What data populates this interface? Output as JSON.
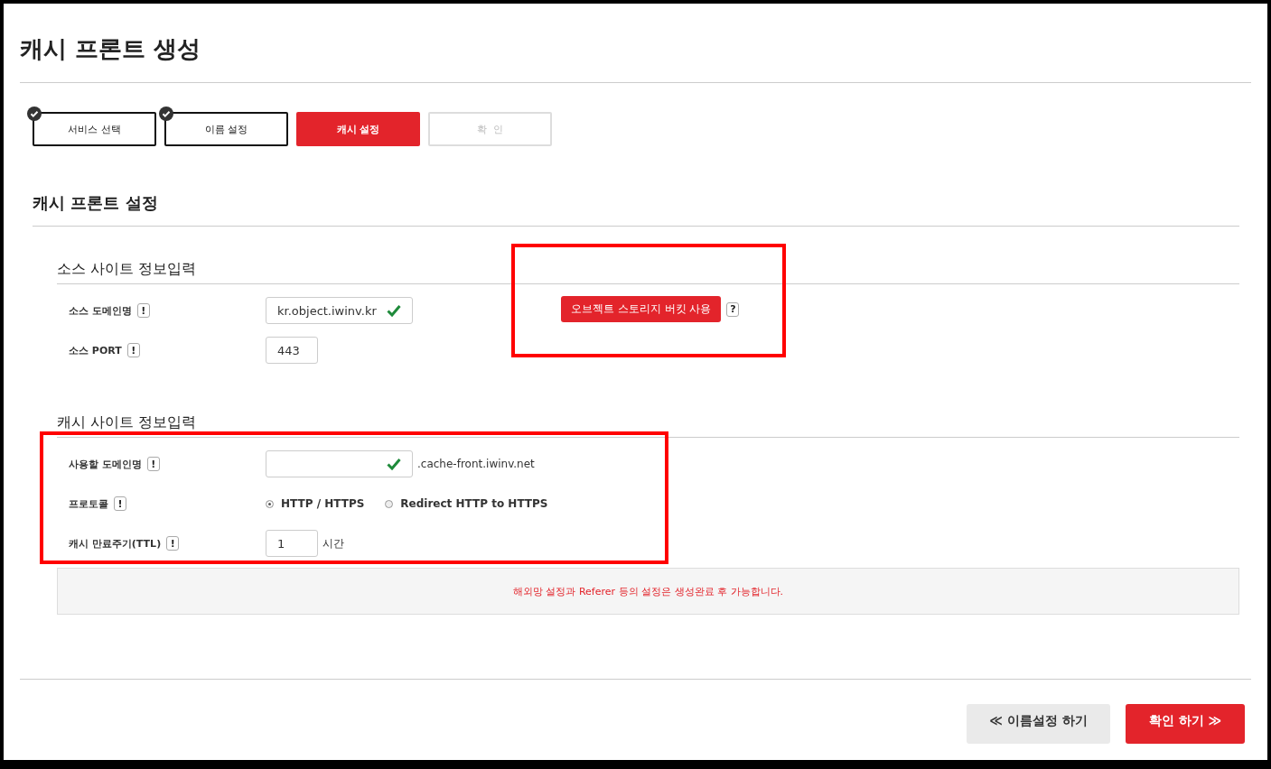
{
  "page_title": "캐시 프론트 생성",
  "steps": [
    {
      "label": "서비스 선택",
      "done": true,
      "selected": false
    },
    {
      "label": "이름 설정",
      "done": true,
      "selected": false
    },
    {
      "label": "캐시 설정",
      "done": false,
      "selected": true
    },
    {
      "label": "확  인",
      "done": false,
      "selected": false
    }
  ],
  "section_title": "캐시 프론트 설정",
  "source_site": {
    "title": "소스 사이트 정보입력",
    "fields": [
      {
        "label": "소스 도메인명",
        "hint": "!",
        "kind": "text",
        "value": "kr.object.iwinv.kr",
        "valid": true
      },
      {
        "label": "소스 PORT",
        "hint": "!",
        "kind": "short",
        "value": "443"
      }
    ],
    "bucket_button": {
      "label": "오브젝트 스토리지 버킷 사용",
      "help": "?",
      "highlighted": true
    }
  },
  "cache_site": {
    "title": "캐시 사이트 정보입력",
    "highlighted": true,
    "fields": [
      {
        "label": "사용할 도메인명",
        "hint": "!",
        "kind": "text",
        "valid": true,
        "suffix": ".cache-front.iwinv.net"
      },
      {
        "label": "프로토콜",
        "hint": "!",
        "kind": "radio",
        "options": [
          {
            "label": "HTTP / HTTPS",
            "selected": true
          },
          {
            "label": "Redirect HTTP to HTTPS",
            "selected": false
          }
        ]
      },
      {
        "label": "캐시 만료주기(TTL)",
        "hint": "!",
        "kind": "short",
        "value": "1",
        "suffix": "시간"
      }
    ]
  },
  "notice": "해외망 설정과 Referer 등의 설정은 생성완료 후 가능합니다.",
  "footer_buttons": [
    {
      "label": "≪ 이름설정 하기",
      "kind": "secondary"
    },
    {
      "label": "확인 하기 ≫",
      "kind": "primary"
    }
  ]
}
